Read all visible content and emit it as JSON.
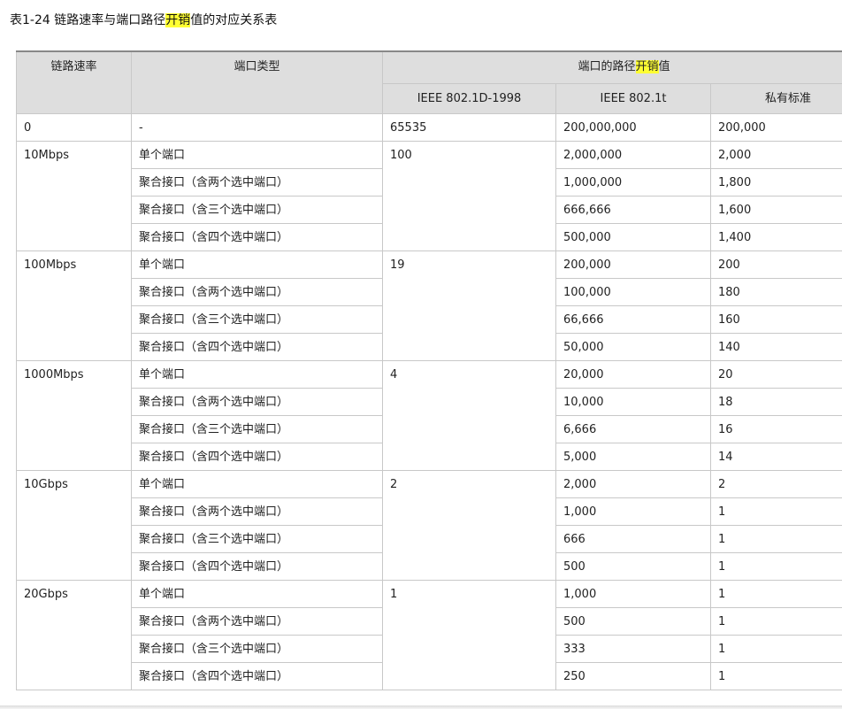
{
  "caption": {
    "prefix": "表1-24 链路速率与端口路径",
    "highlight": "开销",
    "suffix": "值的对应关系表"
  },
  "header": {
    "link_rate": "链路速率",
    "port_type": "端口类型",
    "path_cost_prefix": "端口的路径",
    "path_cost_highlight": "开销",
    "path_cost_suffix": "值",
    "ieee_1998": "IEEE 802.1D-1998",
    "ieee_1t": "IEEE 802.1t",
    "private": "私有标准"
  },
  "row0": {
    "rate": "0",
    "type": "-",
    "ieee1998": "65535",
    "ieee1t": "200,000,000",
    "private": "200,000"
  },
  "groups": [
    {
      "rate": "10Mbps",
      "ieee1998": "100",
      "rows": [
        {
          "type": "单个端口",
          "ieee1t": "2,000,000",
          "private": "2,000"
        },
        {
          "type": "聚合接口（含两个选中端口）",
          "ieee1t": "1,000,000",
          "private": "1,800"
        },
        {
          "type": "聚合接口（含三个选中端口）",
          "ieee1t": "666,666",
          "private": "1,600"
        },
        {
          "type": "聚合接口（含四个选中端口）",
          "ieee1t": "500,000",
          "private": "1,400"
        }
      ]
    },
    {
      "rate": "100Mbps",
      "ieee1998": "19",
      "rows": [
        {
          "type": "单个端口",
          "ieee1t": "200,000",
          "private": "200"
        },
        {
          "type": "聚合接口（含两个选中端口）",
          "ieee1t": "100,000",
          "private": "180"
        },
        {
          "type": "聚合接口（含三个选中端口）",
          "ieee1t": "66,666",
          "private": "160"
        },
        {
          "type": "聚合接口（含四个选中端口）",
          "ieee1t": "50,000",
          "private": "140"
        }
      ]
    },
    {
      "rate": "1000Mbps",
      "ieee1998": "4",
      "rows": [
        {
          "type": "单个端口",
          "ieee1t": "20,000",
          "private": "20"
        },
        {
          "type": "聚合接口（含两个选中端口）",
          "ieee1t": "10,000",
          "private": "18"
        },
        {
          "type": "聚合接口（含三个选中端口）",
          "ieee1t": "6,666",
          "private": "16"
        },
        {
          "type": "聚合接口（含四个选中端口）",
          "ieee1t": "5,000",
          "private": "14"
        }
      ]
    },
    {
      "rate": "10Gbps",
      "ieee1998": "2",
      "rows": [
        {
          "type": "单个端口",
          "ieee1t": "2,000",
          "private": "2"
        },
        {
          "type": "聚合接口（含两个选中端口）",
          "ieee1t": "1,000",
          "private": "1"
        },
        {
          "type": "聚合接口（含三个选中端口）",
          "ieee1t": "666",
          "private": "1"
        },
        {
          "type": "聚合接口（含四个选中端口）",
          "ieee1t": "500",
          "private": "1"
        }
      ]
    },
    {
      "rate": "20Gbps",
      "ieee1998": "1",
      "rows": [
        {
          "type": "单个端口",
          "ieee1t": "1,000",
          "private": "1"
        },
        {
          "type": "聚合接口（含两个选中端口）",
          "ieee1t": "500",
          "private": "1"
        },
        {
          "type": "聚合接口（含三个选中端口）",
          "ieee1t": "333",
          "private": "1"
        },
        {
          "type": "聚合接口（含四个选中端口）",
          "ieee1t": "250",
          "private": "1"
        }
      ]
    }
  ]
}
